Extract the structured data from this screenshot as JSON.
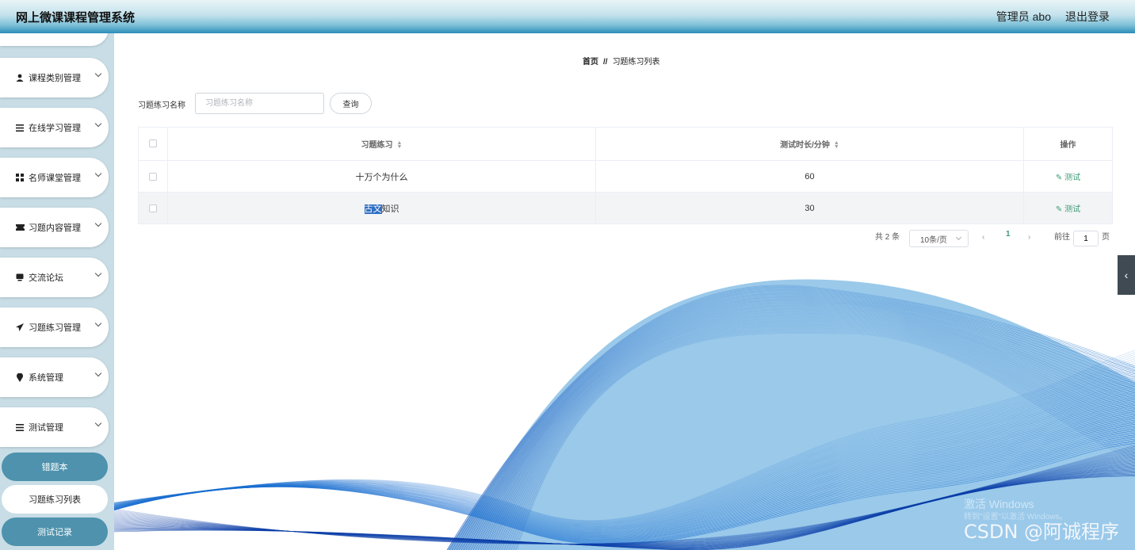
{
  "header": {
    "title": "网上微课课程管理系统",
    "user": "管理员 abo",
    "logout": "退出登录"
  },
  "sidebar": {
    "items": [
      {
        "label": "课程类别管理",
        "icon": "user-icon"
      },
      {
        "label": "在线学习管理",
        "icon": "list-icon"
      },
      {
        "label": "名师课堂管理",
        "icon": "grid-icon"
      },
      {
        "label": "习题内容管理",
        "icon": "ticket-icon"
      },
      {
        "label": "交流论坛",
        "icon": "chat-icon"
      },
      {
        "label": "习题练习管理",
        "icon": "send-icon"
      },
      {
        "label": "系统管理",
        "icon": "pin-icon"
      },
      {
        "label": "测试管理",
        "icon": "list-icon"
      }
    ],
    "subitems": [
      {
        "label": "错题本"
      },
      {
        "label": "习题练习列表"
      },
      {
        "label": "测试记录"
      }
    ]
  },
  "breadcrumb": {
    "home": "首页",
    "sep": "//",
    "current": "习题练习列表"
  },
  "search": {
    "label": "习题练习名称",
    "placeholder": "习题练习名称",
    "button": "查询"
  },
  "table": {
    "columns": [
      "习题练习",
      "测试时长/分钟",
      "操作"
    ],
    "rows": [
      {
        "name": "十万个为什么",
        "duration": "60",
        "action": "测试"
      },
      {
        "name_sel": "古文",
        "name_rest": "知识",
        "duration": "30",
        "action": "测试"
      }
    ]
  },
  "pagination": {
    "total": "共 2 条",
    "page_size": "10条/页",
    "current": "1",
    "goto_label": "前往",
    "goto_value": "1",
    "page_unit": "页"
  },
  "collapse_glyph": "‹",
  "watermark": {
    "line1": "激活 Windows",
    "line2": "转到\"设置\"以激活 Windows。",
    "csdn": "CSDN @阿诚程序"
  },
  "colors": {
    "accent": "#4e92ad",
    "action": "#3e9b76",
    "wave": "#1a6fd1"
  }
}
